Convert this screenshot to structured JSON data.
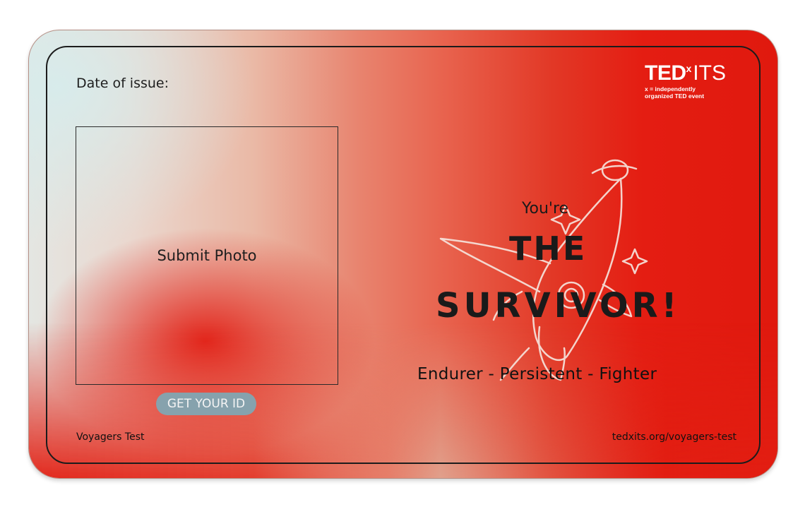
{
  "card": {
    "date_label": "Date of issue:",
    "photo_label": "Submit Photo",
    "cta_label": "GET YOUR ID",
    "footer_left": "Voyagers Test",
    "footer_right": "tedxits.org/voyagers-test"
  },
  "logo": {
    "brand_ted": "TED",
    "brand_x": "x",
    "brand_suffix": "ITS",
    "tagline_line1": "x = independently",
    "tagline_line2": "organized TED event"
  },
  "result": {
    "intro": "You're",
    "title_line1": "THE",
    "title_line2": "SURVIVOR!",
    "traits": "Endurer - Persistent - Fighter"
  },
  "icons": {
    "illustration": "rocket-icon"
  },
  "colors": {
    "accent_red": "#e41d12",
    "button_bg": "#86a2ad",
    "text_dark": "#1a1a1a"
  }
}
